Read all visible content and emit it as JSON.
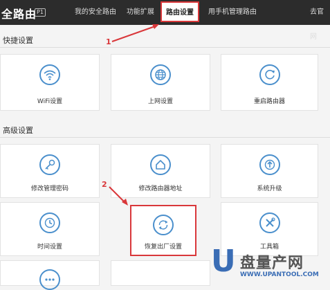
{
  "header": {
    "brand": "全路由",
    "badge": "P1",
    "nav": [
      {
        "label": "我的安全路由"
      },
      {
        "label": "功能扩展"
      },
      {
        "label": "路由设置",
        "active": true
      },
      {
        "label": "用手机管理路由"
      },
      {
        "label": "去官网"
      }
    ]
  },
  "sections": {
    "quick": "快捷设置",
    "advanced": "高级设置"
  },
  "cards": {
    "wifi": "WiFi设置",
    "internet": "上网设置",
    "restart": "重启路由器",
    "password": "修改管理密码",
    "address": "修改路由器地址",
    "upgrade": "系统升级",
    "time": "时间设置",
    "reset": "恢复出厂设置",
    "tools": "工具箱"
  },
  "annotations": {
    "step1": "1",
    "step2": "2"
  },
  "watermark": {
    "logo_letter": "U",
    "brand": "盘量产网",
    "url": "WWW.UPANTOOL.COM"
  },
  "colors": {
    "accent": "#4a8fcc",
    "highlight": "#d9373a",
    "topbar": "#2c2c2c"
  }
}
